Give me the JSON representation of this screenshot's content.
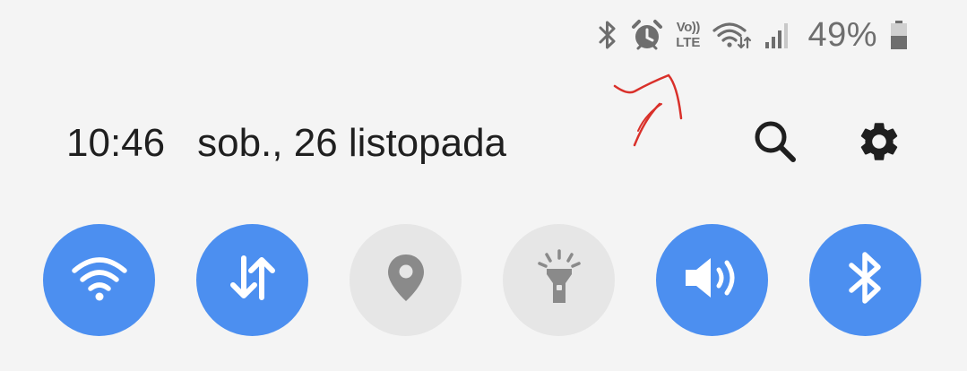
{
  "status_bar": {
    "icons": [
      "bluetooth-icon",
      "alarm-icon",
      "volte-icon",
      "wifi-data-icon",
      "signal-icon",
      "battery-icon"
    ],
    "volte_top": "Vo))",
    "volte_bottom": "LTE",
    "battery_percent": "49%"
  },
  "header": {
    "time": "10:46",
    "date": "sob., 26 listopada"
  },
  "actions": [
    "search-icon",
    "gear-icon"
  ],
  "quick_tiles": [
    {
      "id": "wifi",
      "icon": "wifi-icon",
      "state": "on"
    },
    {
      "id": "mobile-data",
      "icon": "data-arrows-icon",
      "state": "on"
    },
    {
      "id": "location",
      "icon": "location-pin-icon",
      "state": "off"
    },
    {
      "id": "flashlight",
      "icon": "flashlight-icon",
      "state": "off"
    },
    {
      "id": "sound",
      "icon": "speaker-icon",
      "state": "on"
    },
    {
      "id": "bluetooth",
      "icon": "bluetooth-icon",
      "state": "on"
    }
  ],
  "colors": {
    "tile_on": "#4c8ff0",
    "tile_off": "#e6e6e6",
    "status_gray": "#6e6e6e",
    "annotation_red": "#d9302a"
  }
}
